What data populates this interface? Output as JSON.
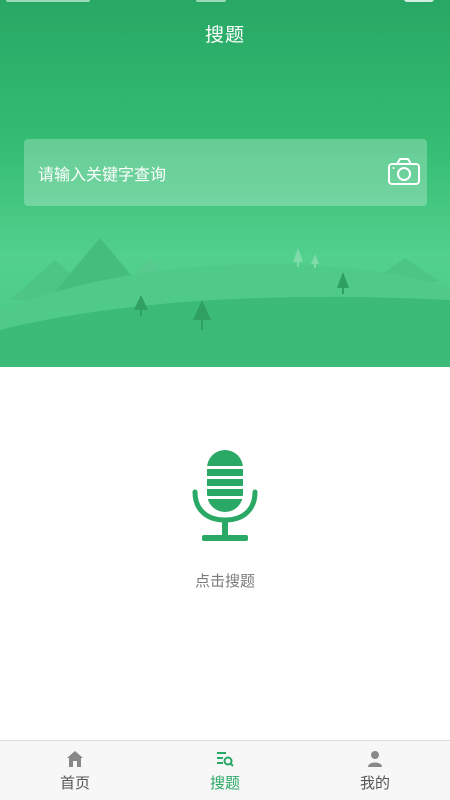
{
  "header": {
    "title": "搜题"
  },
  "search": {
    "placeholder": "请输入关键字查询",
    "camera_icon": "camera-icon"
  },
  "voice": {
    "label": "点击搜题",
    "icon": "microphone-icon"
  },
  "tabbar": {
    "items": [
      {
        "label": "首页",
        "icon": "home-icon",
        "active": false
      },
      {
        "label": "搜题",
        "icon": "search-list-icon",
        "active": true
      },
      {
        "label": "我的",
        "icon": "user-icon",
        "active": false
      }
    ]
  },
  "colors": {
    "brand": "#2aa866",
    "hero_top": "#27a864",
    "hero_bottom": "#49c685",
    "tab_inactive": "#555555",
    "hint_text": "#7a7a7a"
  }
}
